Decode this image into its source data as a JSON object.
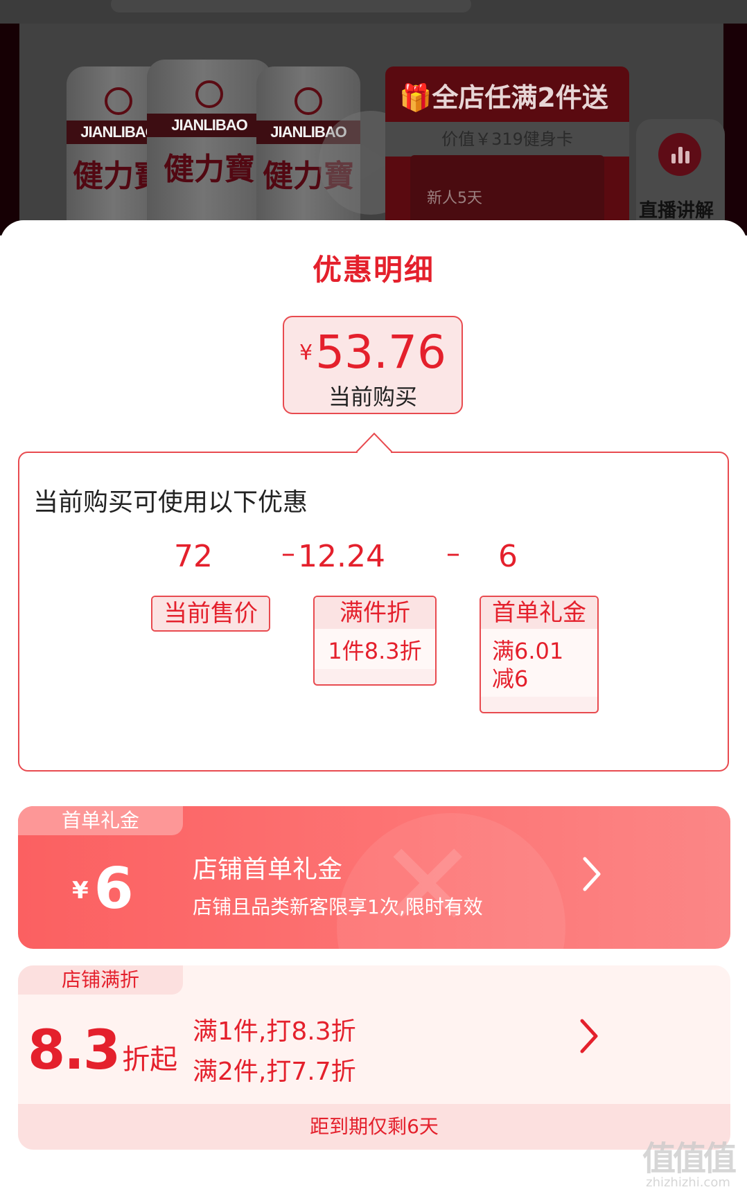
{
  "background": {
    "can_brand": "JIANLIBAO",
    "can_chars": "健力寶",
    "promo_title": "全店任满2件送",
    "promo_sub": "价值￥319健身卡",
    "promo_card": "新人5天",
    "live_label": "直播讲解"
  },
  "sheet": {
    "title": "优惠明细",
    "price": {
      "currency": "¥",
      "value": "53.76",
      "label": "当前购买"
    },
    "panel": {
      "title": "当前购买可使用以下优惠",
      "operator": "–",
      "items": [
        {
          "value": "72",
          "label": "当前售价"
        },
        {
          "value": "12.24",
          "label": "满件折",
          "detail": "1件8.3折"
        },
        {
          "value": "6",
          "label": "首单礼金",
          "detail_lines": [
            "满6.01",
            "减6"
          ]
        }
      ]
    }
  },
  "coupons": [
    {
      "badge": "首单礼金",
      "currency": "¥",
      "amount": "6",
      "title": "店铺首单礼金",
      "description": "店铺且品类新客限享1次,限时有效"
    },
    {
      "badge": "店铺满折",
      "amount": "8.3",
      "amount_suffix": "折起",
      "rules": [
        "满1件,打8.3折",
        "满2件,打7.7折"
      ],
      "footer": "距到期仅剩6天"
    }
  ],
  "watermark": {
    "glyphs": "值值值",
    "url": "zhizhizhi.com"
  },
  "colors": {
    "accent": "#e4202c",
    "border": "#e84a4f",
    "coupon_red": "#fb6061",
    "coupon_light": "#fff3f1"
  },
  "icons": [
    "gift-icon",
    "play-icon",
    "live-bars-icon",
    "chevron-right-icon"
  ]
}
